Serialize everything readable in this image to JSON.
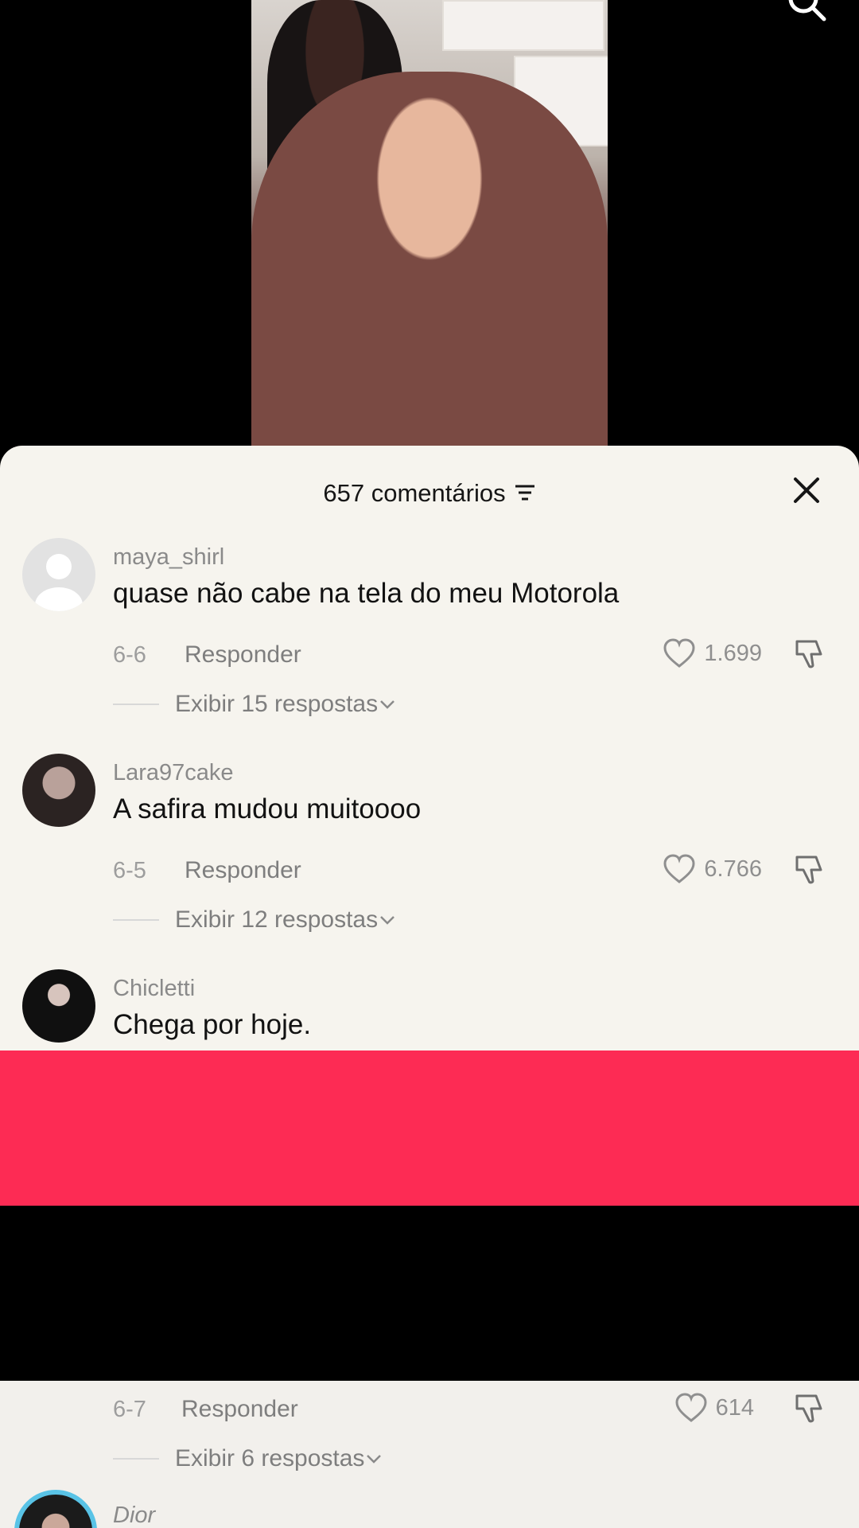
{
  "header": {
    "comments_count_label": "657 comentários"
  },
  "comments": [
    {
      "username": "maya_shirl",
      "text": "quase não cabe na tela do meu Motorola",
      "date": "6-6",
      "reply_label": "Responder",
      "likes": "1.699",
      "view_replies": "Exibir 15 respostas"
    },
    {
      "username": "Lara97cake",
      "text": "A safira mudou muitoooo",
      "date": "6-5",
      "reply_label": "Responder",
      "likes": "6.766",
      "view_replies": "Exibir 12 respostas"
    },
    {
      "username": "Chicletti",
      "text": "Chega por hoje."
    }
  ],
  "lower_comment": {
    "date": "6-7",
    "reply_label": "Responder",
    "likes": "614",
    "view_replies": "Exibir 6 respostas",
    "next_username": "Dior"
  },
  "colors": {
    "accent_band": "#fd2b54",
    "sheet_bg": "#f6f4ee"
  },
  "icons": [
    "search-icon",
    "sort-icon",
    "close-icon",
    "heart-icon",
    "dislike-icon",
    "chevron-down-icon"
  ]
}
